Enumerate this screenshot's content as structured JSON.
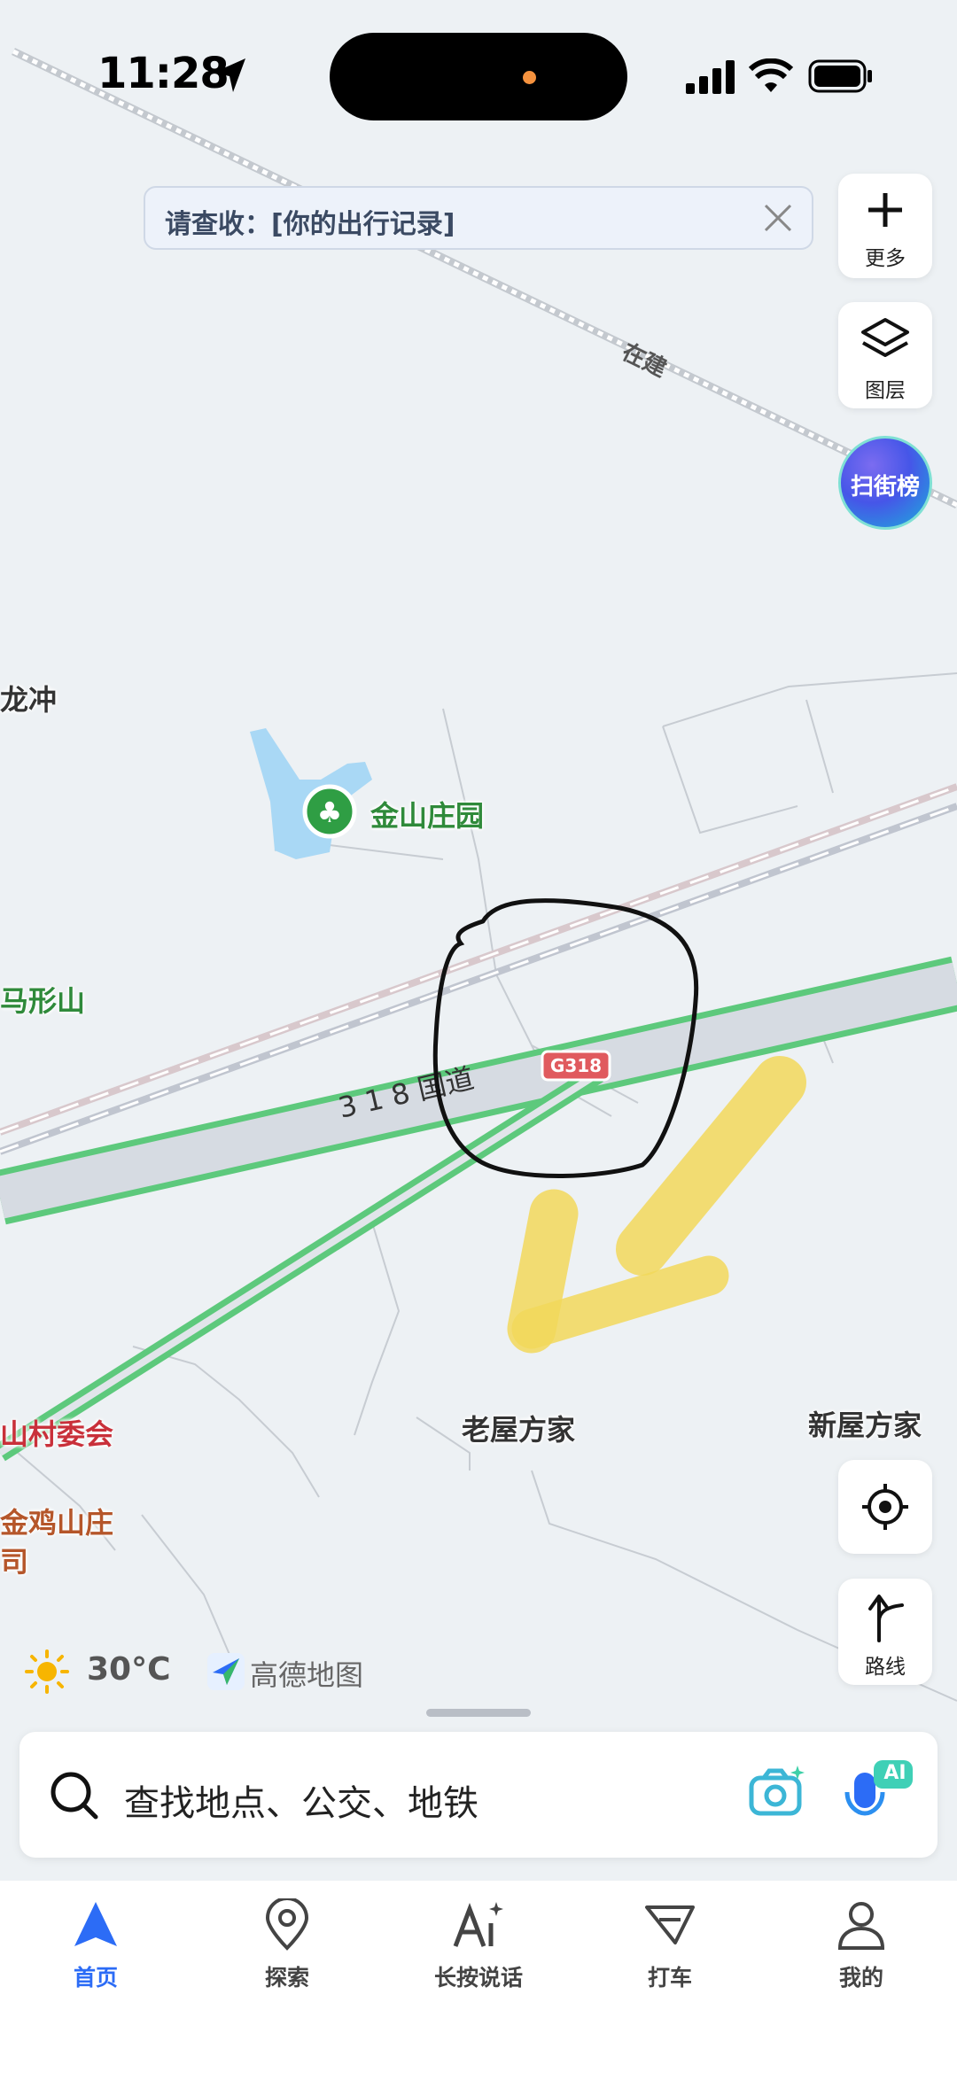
{
  "status_bar": {
    "time": "11:28"
  },
  "notice": {
    "text": "请查收：[你的出行记录]"
  },
  "side_buttons": {
    "more_label": "更多",
    "layers_label": "图层",
    "scan_label": "扫街榜",
    "route_label": "路线"
  },
  "map_labels": {
    "construction": "在建",
    "longchong": "龙冲",
    "jinshan_manor": "金山庄园",
    "maxingshan": "马形山",
    "road_name": "3 1 8 国道",
    "road_shield": "G318",
    "village_committee": "山村委会",
    "jinji_manor": "金鸡山庄",
    "jinji_manor_2": "司",
    "old_house": "老屋方家",
    "new_house": "新屋方家"
  },
  "weather": {
    "temperature": "30°C"
  },
  "brand": {
    "name": "高德地图"
  },
  "search": {
    "placeholder": "查找地点、公交、地铁",
    "ai_badge": "AI"
  },
  "tabs": [
    {
      "label": "首页",
      "icon": "navigation-arrow-icon",
      "active": true
    },
    {
      "label": "探索",
      "icon": "location-pin-icon",
      "active": false
    },
    {
      "label": "长按说话",
      "icon": "ai-voice-icon",
      "active": false
    },
    {
      "label": "打车",
      "icon": "taxi-icon",
      "active": false
    },
    {
      "label": "我的",
      "icon": "person-icon",
      "active": false
    }
  ],
  "colors": {
    "accent": "#2c6cf6",
    "road_green": "#5dc97c",
    "map_bg": "#edf1f4",
    "water": "#a9d8f5"
  }
}
